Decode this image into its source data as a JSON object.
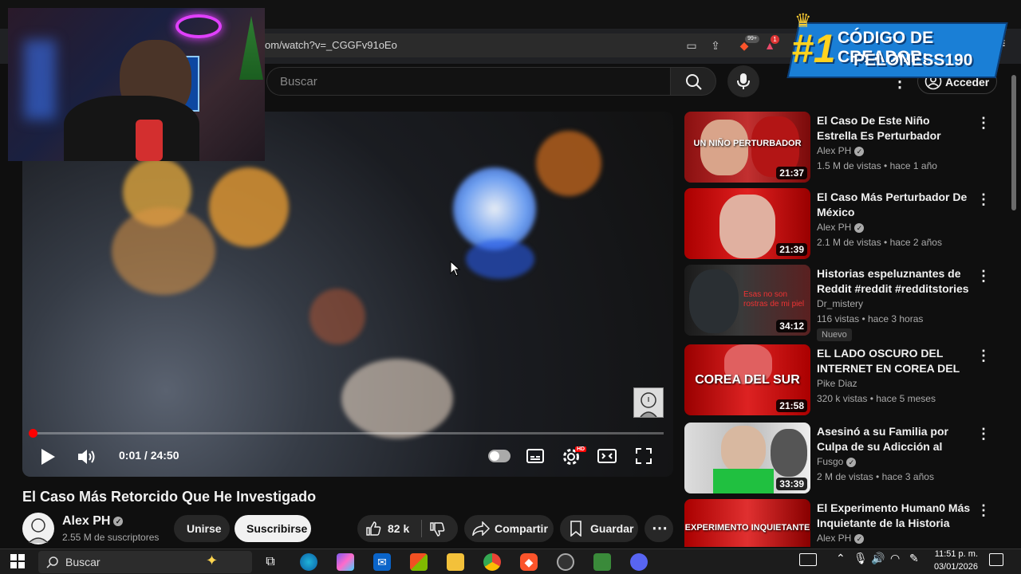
{
  "browser": {
    "url": "om/watch?v=_CGGFv91oEo",
    "brave_badge": "99+",
    "alert_badge": "1"
  },
  "header": {
    "search_placeholder": "Buscar",
    "login_label": "Acceder"
  },
  "player": {
    "time": "0:01 / 24:50",
    "progress": 0.0007,
    "hd_badge": "HD"
  },
  "video": {
    "title": "El Caso Más Retorcido Que He Investigado",
    "channel": "Alex PH",
    "subscribers": "2.55 M de suscriptores",
    "join_label": "Unirse",
    "subscribe_label": "Suscribirse",
    "likes": "82 k",
    "share_label": "Compartir",
    "save_label": "Guardar"
  },
  "creator_code": {
    "rank": "#1",
    "line1": "CÓDIGO DE CREADOR:",
    "line2": "PELONESS190"
  },
  "related": [
    {
      "title": "El Caso De Este Niño Estrella Es Perturbador",
      "channel": "Alex PH",
      "verified": true,
      "meta": "1.5 M de vistas • hace 1 año",
      "duration": "21:37",
      "thumb_caption": "UN NIÑO PERTURBADOR",
      "badge": ""
    },
    {
      "title": "El Caso Más Perturbador De México",
      "channel": "Alex PH",
      "verified": true,
      "meta": "2.1 M de vistas • hace 2 años",
      "duration": "21:39",
      "thumb_caption": "",
      "badge": ""
    },
    {
      "title": "Historias espeluznantes de Reddit #reddit #redditstories",
      "channel": "Dr_mistery",
      "verified": false,
      "meta": "116 vistas • hace 3 horas",
      "duration": "34:12",
      "thumb_caption": "Esas no son rostras de mi piel",
      "badge": "Nuevo"
    },
    {
      "title": "EL LADO OSCURO DEL INTERNET EN COREA DEL SU...",
      "channel": "Pike Diaz",
      "verified": false,
      "meta": "320 k vistas • hace 5 meses",
      "duration": "21:58",
      "thumb_caption": "COREA DEL SUR",
      "badge": ""
    },
    {
      "title": "Asesinó a su Familia por Culpa de su Adicción al Nopor",
      "channel": "Fusgo",
      "verified": true,
      "meta": "2 M de vistas • hace 3 años",
      "duration": "33:39",
      "thumb_caption": "",
      "badge": ""
    },
    {
      "title": "El Experimento Human0 Más Inquietante de la Historia",
      "channel": "Alex PH",
      "verified": true,
      "meta": "",
      "duration": "",
      "thumb_caption": "EXPERIMENTO INQUIETANTE",
      "badge": ""
    }
  ],
  "taskbar": {
    "search_label": "Buscar",
    "time": "11:51 p. m.",
    "date": "03/01/2026"
  },
  "colors": {
    "accent_red": "#ff0000",
    "bg": "#0f0f0f",
    "pill": "#272727"
  }
}
